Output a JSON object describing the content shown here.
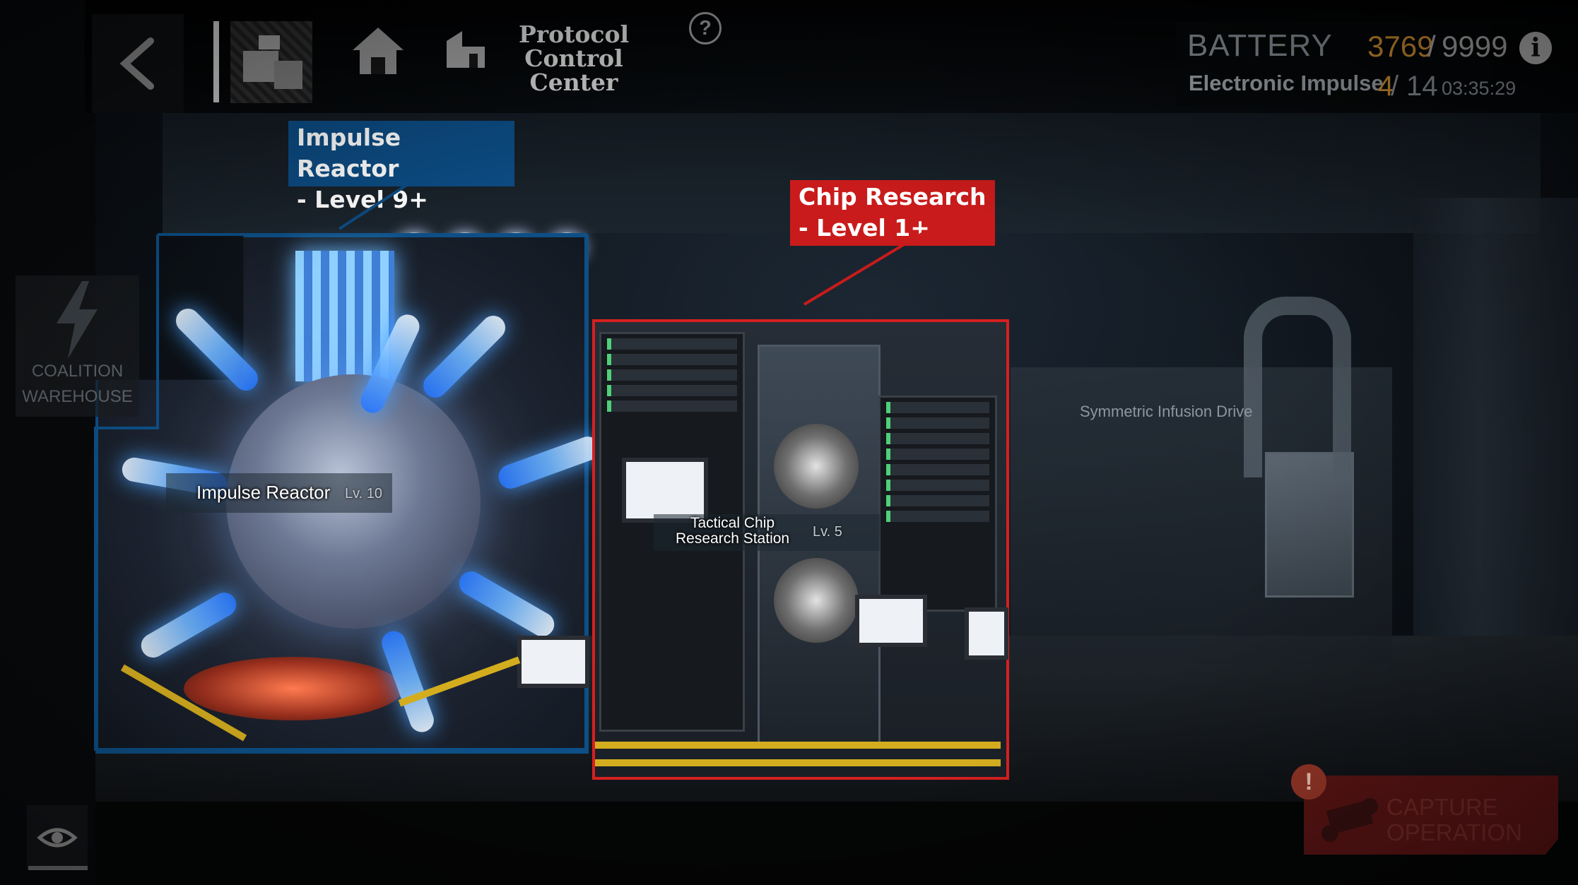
{
  "topbar": {
    "back_icon": "chevron-left-icon",
    "menu_icon": "facility-menu-icon",
    "home_icon": "home-icon",
    "location_icon": "building-icon",
    "location_title": "Protocol Control Center",
    "help_label": "?"
  },
  "battery": {
    "title": "BATTERY",
    "current": "3769",
    "separator": "/",
    "max": "9999",
    "impulse_label": "Electronic Impulse",
    "impulse_current": "4",
    "impulse_separator": "/",
    "impulse_max": "14",
    "impulse_timer": "03:35:29",
    "info_label": "i"
  },
  "sidebar": {
    "warehouse_label": "COALITION WAREHOUSE",
    "warehouse_icon": "lightning-icon"
  },
  "callouts": {
    "reactor": {
      "line1": "Impulse Reactor",
      "line2": "- Level 9+",
      "color": "#0c4b82"
    },
    "chip": {
      "line1": "Chip Research",
      "line2": "- Level 1+",
      "color": "#c91b1b"
    }
  },
  "facilities": {
    "reactor": {
      "name": "Impulse Reactor",
      "level": "Lv. 10",
      "frame_color": "#0d4f86"
    },
    "chip_station": {
      "name_line1": "Tactical Chip",
      "name_line2": "Research Station",
      "level": "Lv. 5",
      "frame_color": "#d62020"
    },
    "infusion_drive": {
      "name": "Symmetric Infusion Drive"
    }
  },
  "bottom": {
    "eye_icon": "eye-icon",
    "capture_label_line1": "CAPTURE",
    "capture_label_line2": "OPERATION",
    "capture_icon": "drone-icon",
    "alert_label": "!"
  },
  "colors": {
    "accent_orange": "#e09a34",
    "capture_red": "#601515"
  }
}
